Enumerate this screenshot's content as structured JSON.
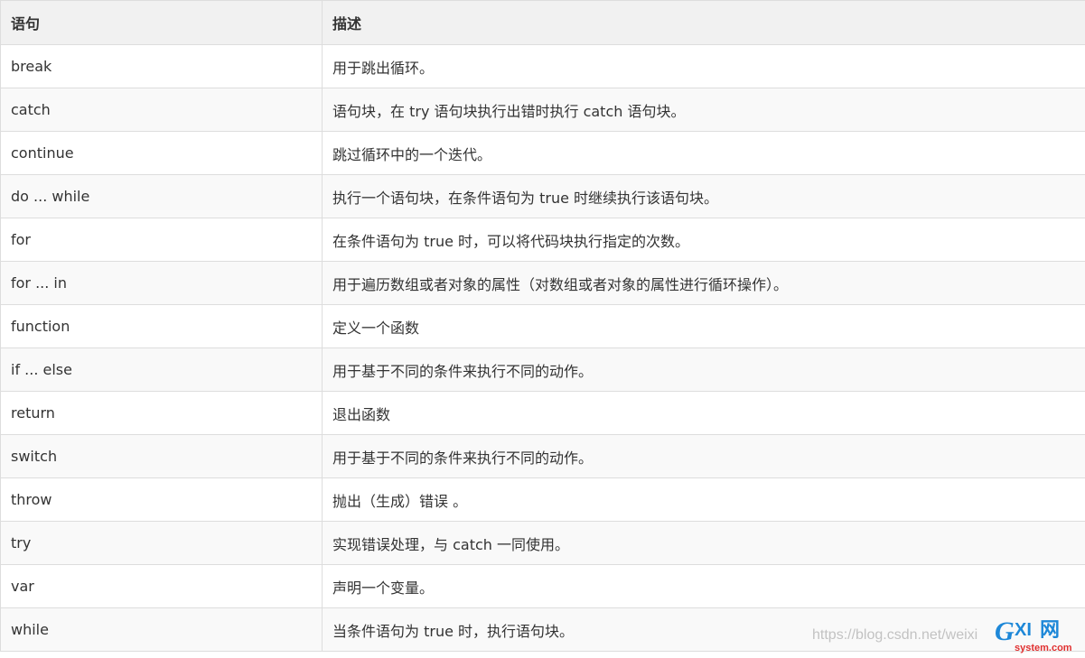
{
  "table": {
    "headers": [
      "语句",
      "描述"
    ],
    "rows": [
      [
        "break",
        "用于跳出循环。"
      ],
      [
        "catch",
        "语句块，在 try 语句块执行出错时执行 catch 语句块。"
      ],
      [
        "continue",
        "跳过循环中的一个迭代。"
      ],
      [
        "do ... while",
        "执行一个语句块，在条件语句为 true 时继续执行该语句块。"
      ],
      [
        "for",
        "在条件语句为 true 时，可以将代码块执行指定的次数。"
      ],
      [
        "for ... in",
        "用于遍历数组或者对象的属性（对数组或者对象的属性进行循环操作）。"
      ],
      [
        "function",
        "定义一个函数"
      ],
      [
        "if ... else",
        "用于基于不同的条件来执行不同的动作。"
      ],
      [
        "return",
        "退出函数"
      ],
      [
        "switch",
        "用于基于不同的条件来执行不同的动作。"
      ],
      [
        "throw",
        "抛出（生成）错误 。"
      ],
      [
        "try",
        "实现错误处理，与 catch 一同使用。"
      ],
      [
        "var",
        "声明一个变量。"
      ],
      [
        "while",
        "当条件语句为 true 时，执行语句块。"
      ]
    ]
  },
  "watermark": {
    "url": "https://blog.csdn.net/weixi",
    "logo_text": "GXI网",
    "logo_sub": "system.com"
  },
  "colors": {
    "header_bg": "#f1f1f1",
    "row_alt_bg": "#f9f9f9",
    "border": "#dddddd",
    "text": "#333333",
    "logo_blue": "#1e88d8",
    "logo_red": "#e03030"
  }
}
